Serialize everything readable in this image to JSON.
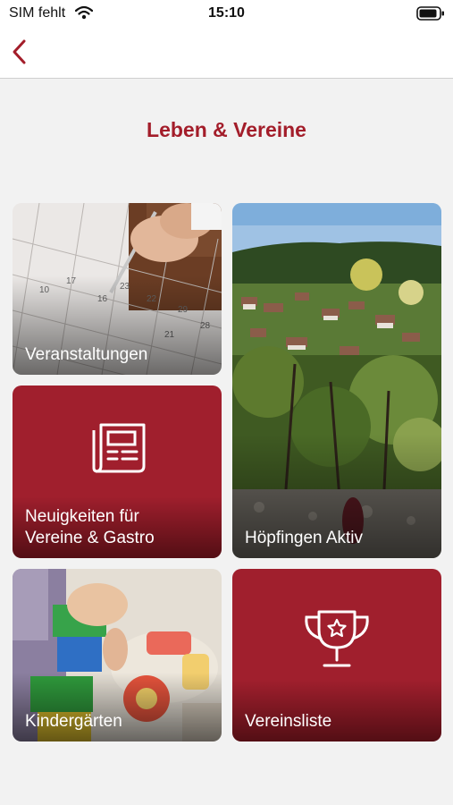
{
  "status_bar": {
    "carrier": "SIM fehlt",
    "time": "15:10",
    "wifi_icon": "wifi-icon",
    "battery_icon": "battery-icon"
  },
  "nav": {
    "back_icon": "chevron-left-icon"
  },
  "page": {
    "title": "Leben & Vereine"
  },
  "tiles": [
    {
      "label": "Veranstaltungen",
      "style": "photo",
      "photo": "calendar-photo"
    },
    {
      "label": "Höpfingen Aktiv",
      "style": "photo",
      "photo": "village-landscape-photo"
    },
    {
      "label_line1": "Neuigkeiten für",
      "label_line2": "Vereine & Gastro",
      "style": "brand",
      "icon": "newspaper-icon"
    },
    {
      "label": "Kindergärten",
      "style": "photo",
      "photo": "toy-blocks-photo"
    },
    {
      "label": "Vereinsliste",
      "style": "brand",
      "icon": "trophy-icon"
    }
  ],
  "colors": {
    "brand_red": "#a31d2a",
    "tile_red": "#a01f2d",
    "background": "#f2f2f2"
  }
}
